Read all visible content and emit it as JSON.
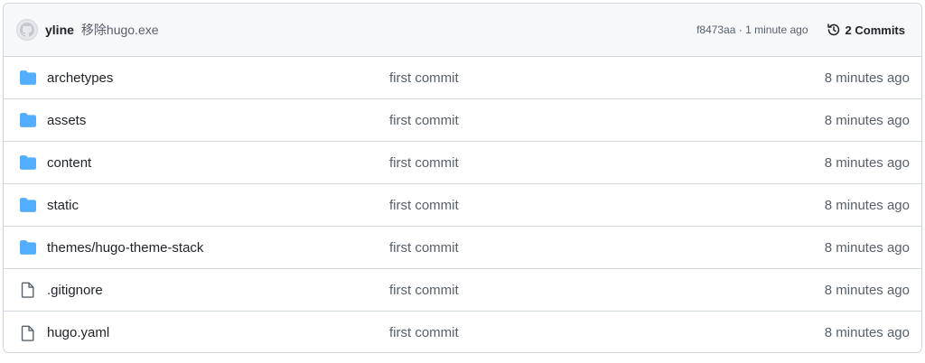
{
  "header": {
    "author": "yline",
    "message": "移除hugo.exe",
    "sha": "f8473aa",
    "separator": " · ",
    "time": "1 minute ago",
    "commits_label": "2 Commits"
  },
  "colors": {
    "folder": "#54aeff",
    "file": "#57606a",
    "border": "#d0d7de",
    "header_bg": "#f6f8fa"
  },
  "rows": [
    {
      "type": "folder",
      "icon": "folder-icon",
      "name": "archetypes",
      "message": "first commit",
      "time": "8 minutes ago"
    },
    {
      "type": "folder",
      "icon": "folder-icon",
      "name": "assets",
      "message": "first commit",
      "time": "8 minutes ago"
    },
    {
      "type": "folder",
      "icon": "folder-icon",
      "name": "content",
      "message": "first commit",
      "time": "8 minutes ago"
    },
    {
      "type": "folder",
      "icon": "folder-icon",
      "name": "static",
      "message": "first commit",
      "time": "8 minutes ago"
    },
    {
      "type": "folder",
      "icon": "folder-icon",
      "name": "themes/hugo-theme-stack",
      "message": "first commit",
      "time": "8 minutes ago"
    },
    {
      "type": "file",
      "icon": "file-icon",
      "name": ".gitignore",
      "message": "first commit",
      "time": "8 minutes ago"
    },
    {
      "type": "file",
      "icon": "file-icon",
      "name": "hugo.yaml",
      "message": "first commit",
      "time": "8 minutes ago"
    }
  ]
}
